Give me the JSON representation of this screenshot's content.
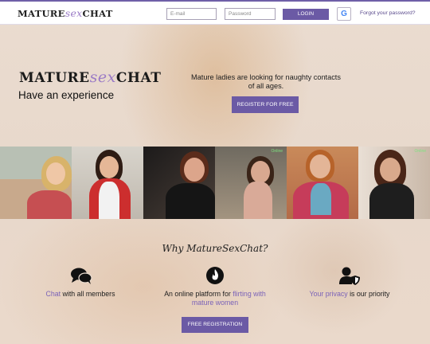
{
  "header": {
    "logo": {
      "pre": "MATURE",
      "accent": "sex",
      "post": "CHAT"
    },
    "email_placeholder": "E-mail",
    "password_placeholder": "Password",
    "login_label": "LOGIN",
    "google_label": "G",
    "forgot_label": "Forgot your password?"
  },
  "hero": {
    "logo": {
      "pre": "MATURE",
      "accent": "sex",
      "post": "CHAT"
    },
    "tagline": "Have an experience",
    "text": "Mature ladies are looking for naughty contacts of all ages.",
    "register_label": "REGISTER FOR FREE"
  },
  "photos": [
    {
      "alt": "member-photo-1",
      "online": ""
    },
    {
      "alt": "member-photo-2",
      "online": ""
    },
    {
      "alt": "member-photo-3",
      "online": ""
    },
    {
      "alt": "member-photo-4",
      "online": "Online"
    },
    {
      "alt": "member-photo-5",
      "online": ""
    },
    {
      "alt": "member-photo-6",
      "online": "Online"
    }
  ],
  "why": {
    "title": "Why MatureSexChat?",
    "features": [
      {
        "icon": "chat-bubbles-icon",
        "pre": "",
        "highlight": "Chat",
        "post": " with all members"
      },
      {
        "icon": "flame-icon",
        "pre": "An online platform for ",
        "highlight": "flirting with mature women",
        "post": ""
      },
      {
        "icon": "user-shield-icon",
        "pre": "",
        "highlight": "Your privacy",
        "post": " is our priority"
      }
    ],
    "register_label": "FREE REGISTRATION"
  },
  "colors": {
    "accent": "#6b5aa5",
    "highlight": "#7b63b8",
    "logo_sex": "#9b7bc6"
  }
}
